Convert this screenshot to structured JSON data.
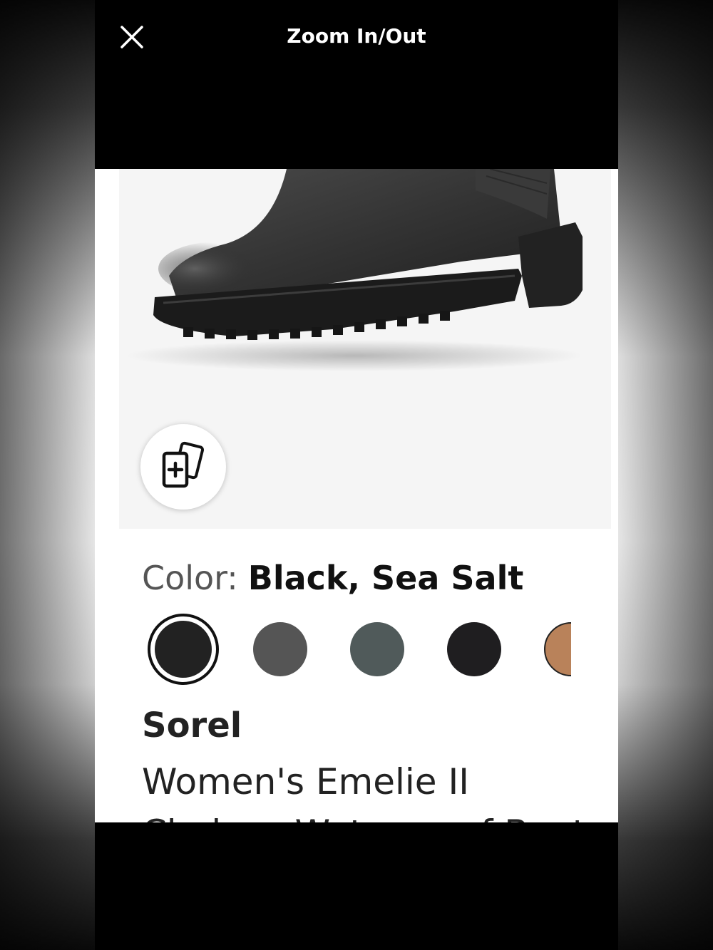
{
  "header": {
    "title": "Zoom In/Out",
    "close_icon": "close-icon"
  },
  "image_viewer": {
    "compare_icon": "add-to-compare-cards-icon"
  },
  "product": {
    "color_label": "Color:",
    "color_value": "Black, Sea Salt",
    "swatches": [
      {
        "color": "#222222",
        "selected": true
      },
      {
        "color": "#555555",
        "selected": false
      },
      {
        "color": "#505a5a",
        "selected": false
      },
      {
        "color": "#1f1e20",
        "selected": false
      },
      {
        "color": "#b9825a",
        "selected": false
      }
    ],
    "brand": "Sorel",
    "name_line1": "Women's Emelie II",
    "name_line2": "Chelsea Waterproof Boot"
  }
}
